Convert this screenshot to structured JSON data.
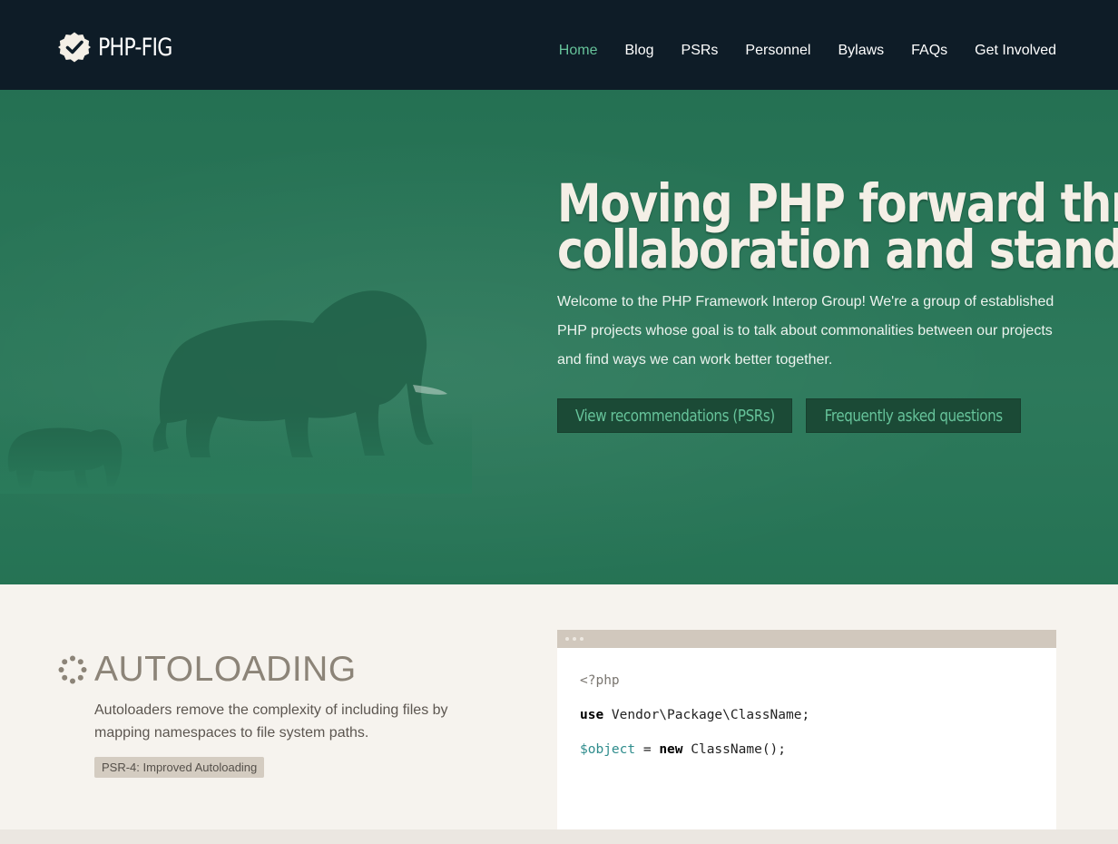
{
  "header": {
    "logo_text": "PHP-FIG",
    "nav": [
      {
        "label": "Home",
        "active": true
      },
      {
        "label": "Blog"
      },
      {
        "label": "PSRs"
      },
      {
        "label": "Personnel"
      },
      {
        "label": "Bylaws"
      },
      {
        "label": "FAQs"
      },
      {
        "label": "Get Involved"
      }
    ]
  },
  "hero": {
    "title_line1": "Moving PHP forward through",
    "title_line2": "collaboration and standards.",
    "description": "Welcome to the PHP Framework Interop Group! We're a group of established PHP projects whose goal is to talk about commonalities between our projects and find ways we can work better together.",
    "primary_button": "View recommendations (PSRs)",
    "secondary_button": "Frequently asked questions",
    "image": "elephants"
  },
  "feature": {
    "icon": "spinner-icon",
    "title": "AUTOLOADING",
    "description": "Autoloaders remove the complexity of including files by mapping namespaces to file system paths.",
    "tag": "PSR-4: Improved Autoloading"
  },
  "code_sample": {
    "line1": "<?php",
    "line2_kw": "use",
    "line2_rest": " Vendor\\Package\\ClassName;",
    "line3_var": "$object",
    "line3_eq": " = ",
    "line3_kw": "new",
    "line3_rest": " ClassName();"
  },
  "colors": {
    "header_bg": "#0e1c27",
    "hero_bg": "#267556",
    "accent": "#66c39a",
    "page_bg": "#f6f3ee"
  }
}
